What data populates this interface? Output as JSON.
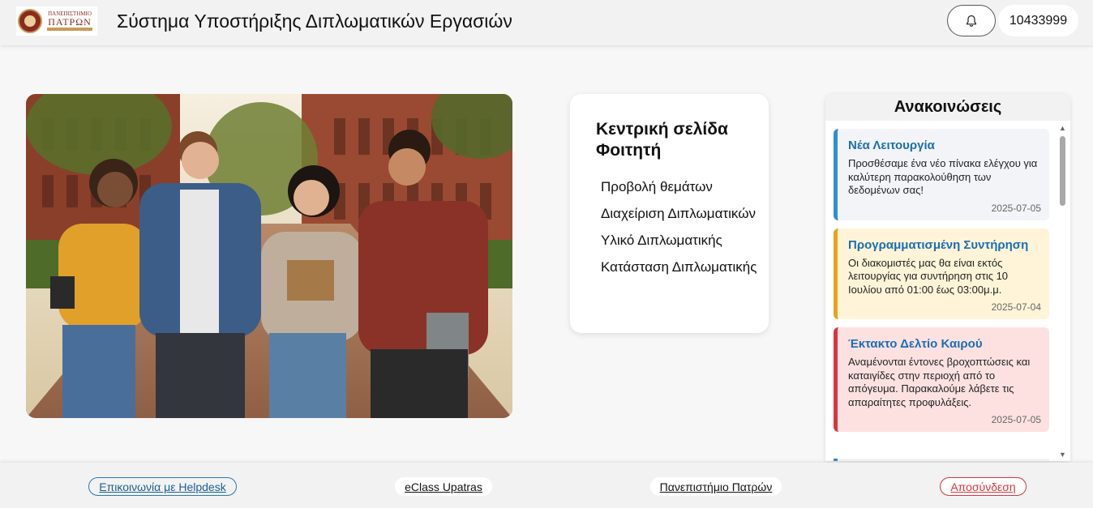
{
  "header": {
    "logo_line1": "ΠΑΝΕΠΙΣΤΗΜΙΟ",
    "logo_line2": "ΠΑΤΡΩΝ",
    "title": "Σύστημα Υποστήριξης Διπλωματικών Εργασιών",
    "notifications_icon": "bell-icon",
    "user_id": "10433999"
  },
  "hero": {
    "image_description_icon": "students-photo"
  },
  "nav": {
    "title": "Κεντρική σελίδα Φοιτητή",
    "items": [
      {
        "label": "Προβολή θεμάτων"
      },
      {
        "label": "Διαχείριση Διπλωματικών"
      },
      {
        "label": "Υλικό Διπλωματικής"
      },
      {
        "label": "Κατάσταση Διπλωματικής"
      }
    ]
  },
  "announcements": {
    "heading": "Ανακοινώσεις",
    "items": [
      {
        "title": "Νέα Λειτουργία",
        "text": "Προσθέσαμε ένα νέο πίνακα ελέγχου για καλύτερη παρακολούθηση των δεδομένων σας!",
        "date": "2025-07-05",
        "color": "#2e8fd4"
      },
      {
        "title": "Προγραμματισμένη Συντήρηση",
        "text": "Οι διακομιστές μας θα είναι εκτός λειτουργίας για συντήρηση στις 10 Ιουλίου από 01:00 έως 03:00μ.μ.",
        "date": "2025-07-04",
        "color": "#e8a21c"
      },
      {
        "title": "Έκτακτο Δελτίο Καιρού",
        "text": "Αναμένονται έντονες βροχοπτώσεις και καταιγίδες στην περιοχή από το απόγευμα. Παρακαλούμε λάβετε τις απαραίτητες προφυλάξεις.",
        "date": "2025-07-05",
        "color": "#d9363e"
      }
    ]
  },
  "footer": {
    "helpdesk": "Επικοινωνία με Helpdesk",
    "eclass": "eClass Upatras",
    "university": "Πανεπιστήμιο Πατρών",
    "logout": "Αποσύνδεση"
  }
}
